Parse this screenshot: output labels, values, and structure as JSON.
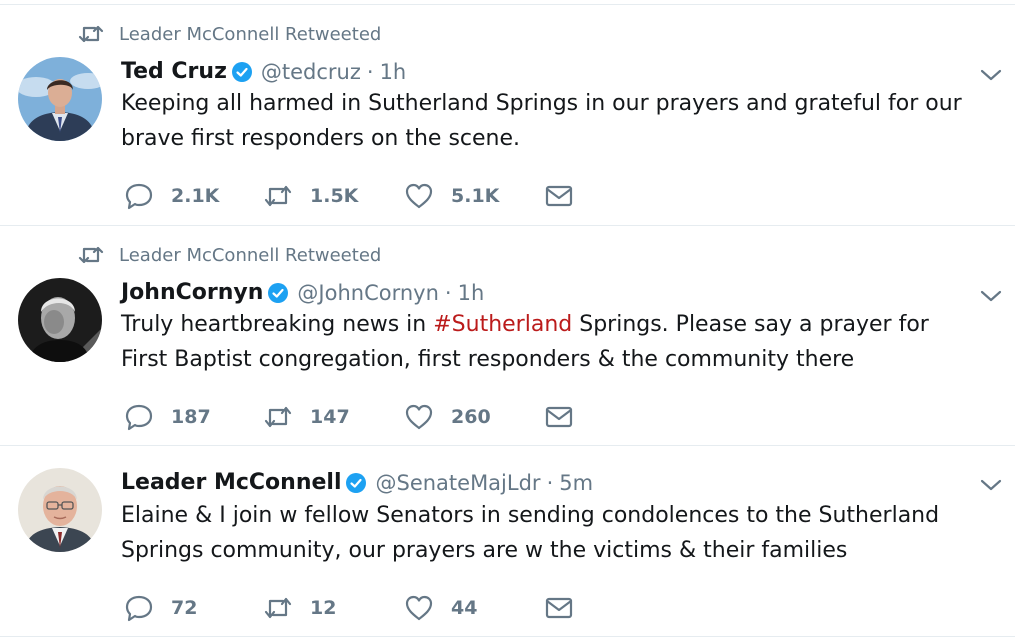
{
  "colors": {
    "hashtag": "#bb1b1b",
    "verified": "#1da1f2",
    "secondary": "#657786"
  },
  "tweets": [
    {
      "retweeted_by": "Leader McConnell Retweeted",
      "name": "Ted Cruz",
      "handle": "@tedcruz",
      "dot": "·",
      "time": "1h",
      "text": "Keeping all harmed in Sutherland Springs in our prayers and grateful for our brave first responders on the scene.",
      "replies": "2.1K",
      "retweets": "1.5K",
      "likes": "5.1K"
    },
    {
      "retweeted_by": "Leader McConnell Retweeted",
      "name": "JohnCornyn",
      "handle": "@JohnCornyn",
      "dot": "·",
      "time": "1h",
      "text_before": "Truly heartbreaking news in ",
      "hashtag": "#Sutherland",
      "text_after": " Springs. Please say a prayer for First Baptist congregation, first responders & the community there",
      "replies": "187",
      "retweets": "147",
      "likes": "260"
    },
    {
      "name": "Leader McConnell",
      "handle": "@SenateMajLdr",
      "dot": "·",
      "time": "5m",
      "text": "Elaine & I join w fellow Senators in sending condolences to the Sutherland Springs community, our prayers are w the victims & their families",
      "replies": "72",
      "retweets": "12",
      "likes": "44"
    }
  ]
}
